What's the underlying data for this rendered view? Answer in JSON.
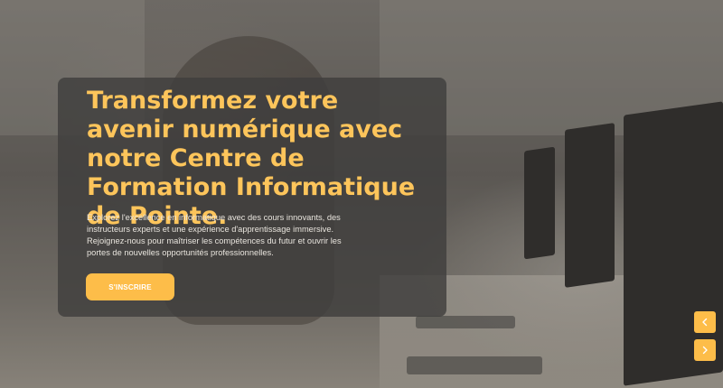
{
  "hero": {
    "title": "Transformez votre avenir numérique avec notre Centre de Formation Informatique de Pointe.",
    "description": "Explorez l'excellence en informatique avec des cours innovants, des instructeurs experts et une expérience d'apprentissage immersive. Rejoignez-nous pour maîtriser les compétences du futur et ouvrir les portes de nouvelles opportunités professionnelles.",
    "cta_label": "S'INSCRIRE"
  },
  "slider": {
    "prev_icon": "chevron-left-icon",
    "next_icon": "chevron-right-icon"
  },
  "colors": {
    "accent": "#fdbd49",
    "title": "#fdc55b",
    "panel": "#403e3d"
  }
}
